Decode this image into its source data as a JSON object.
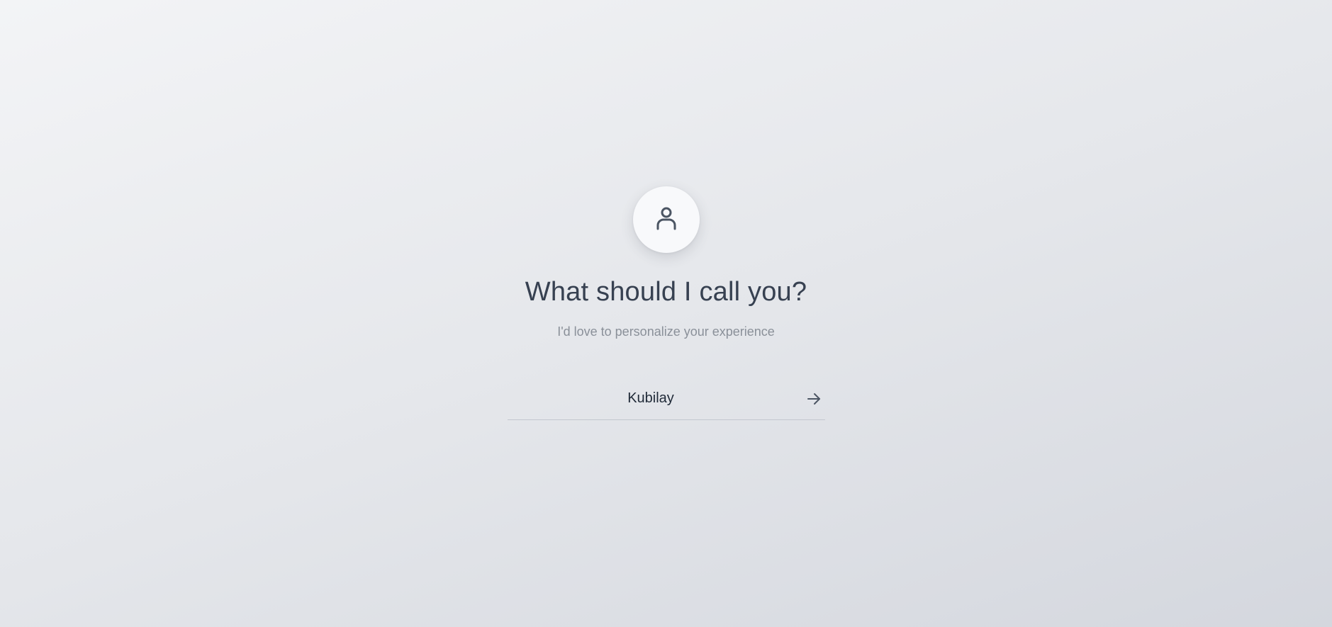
{
  "onboarding": {
    "avatar_icon": "user-icon",
    "title": "What should I call you?",
    "subtitle": "I'd love to personalize your experience",
    "name_input": {
      "value": "Kubilay",
      "placeholder": ""
    },
    "submit_icon": "arrow-right-icon"
  },
  "colors": {
    "background_start": "#f3f4f6",
    "background_end": "#d4d7de",
    "title": "#374151",
    "subtitle": "#8a9099",
    "icon": "#4b5563",
    "underline": "#c3c7cf"
  }
}
